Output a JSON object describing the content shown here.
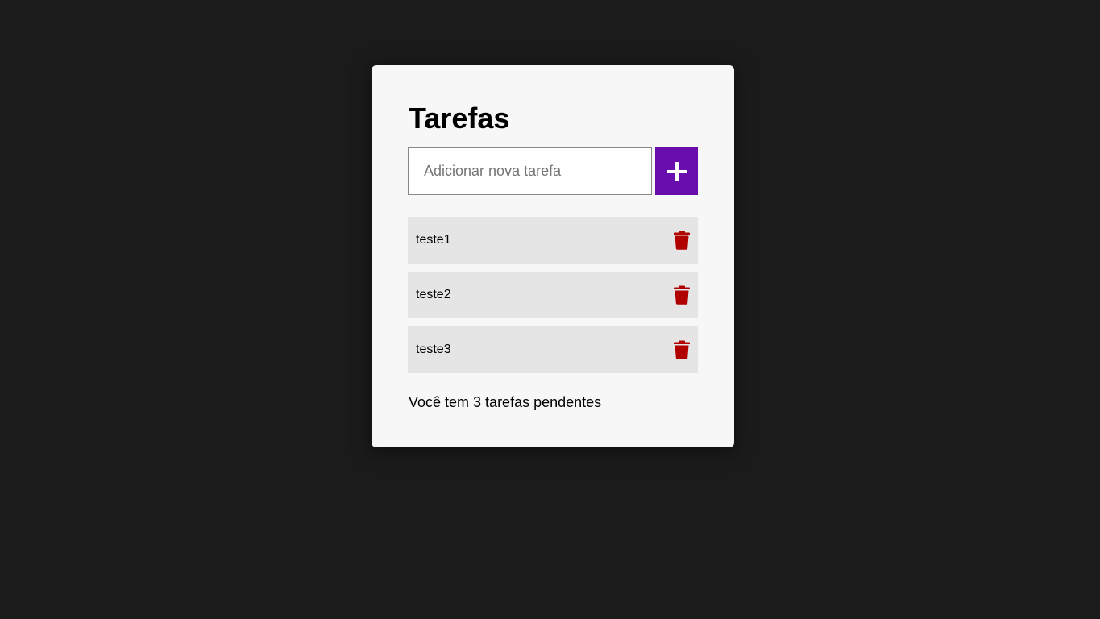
{
  "title": "Tarefas",
  "input": {
    "placeholder": "Adicionar nova tarefa",
    "value": ""
  },
  "add_button": {
    "icon": "plus-icon"
  },
  "tasks": [
    {
      "label": "teste1",
      "delete_icon": "trash-icon"
    },
    {
      "label": "teste2",
      "delete_icon": "trash-icon"
    },
    {
      "label": "teste3",
      "delete_icon": "trash-icon"
    }
  ],
  "footer": {
    "pending_text": "Você tem 3 tarefas pendentes"
  },
  "colors": {
    "background": "#1b1b1b",
    "card": "#f7f7f7",
    "accent": "#6a0dad",
    "task_bg": "#e5e5e5",
    "delete": "#b00000"
  }
}
